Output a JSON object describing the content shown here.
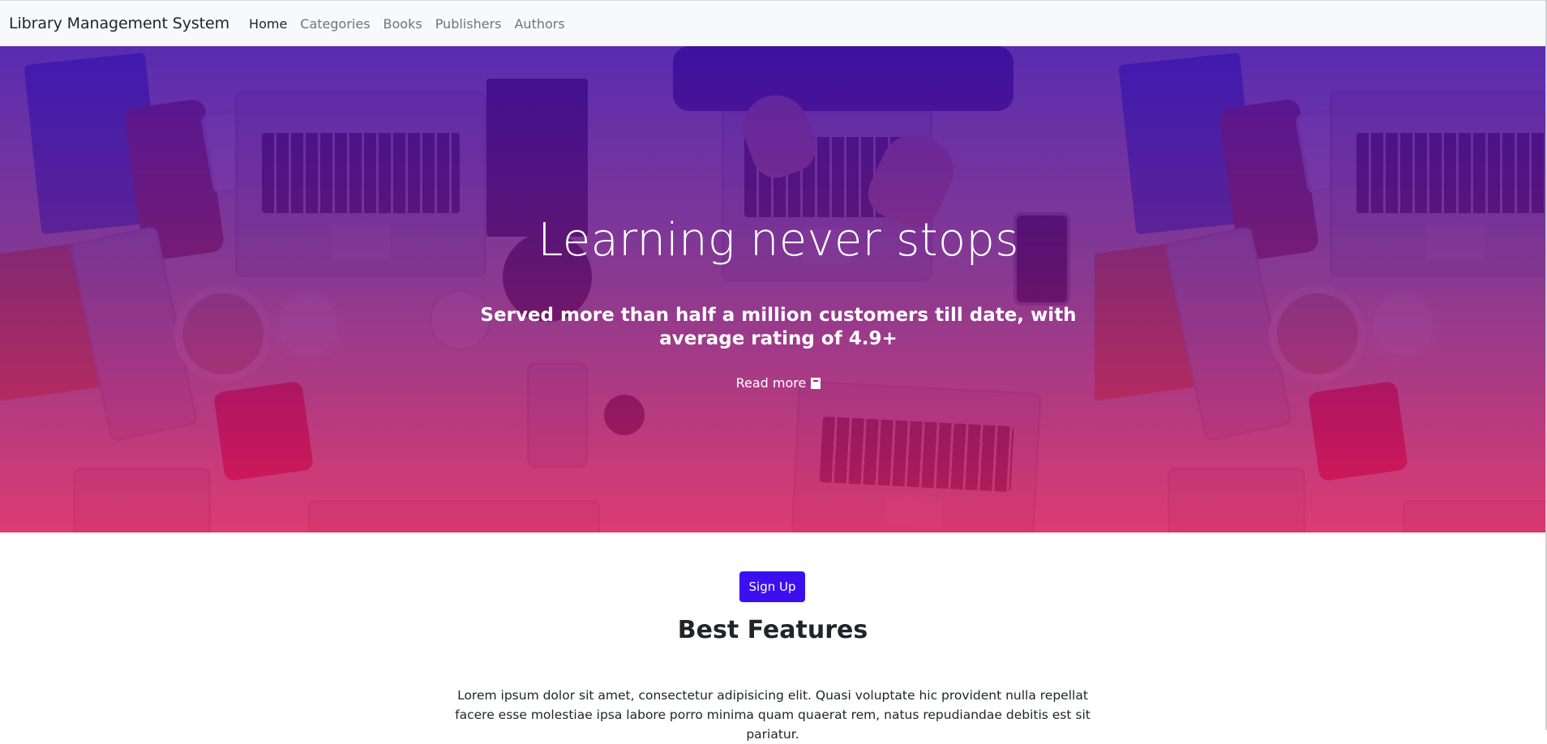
{
  "navbar": {
    "brand": "Library Management System",
    "links": [
      {
        "label": "Home",
        "active": true
      },
      {
        "label": "Categories",
        "active": false
      },
      {
        "label": "Books",
        "active": false
      },
      {
        "label": "Publishers",
        "active": false
      },
      {
        "label": "Authors",
        "active": false
      }
    ]
  },
  "hero": {
    "title": "Learning never stops",
    "subtitle": "Served more than half a million customers till date, with average rating of 4.9+",
    "read_more": "Read more",
    "read_more_icon": "book-icon",
    "gradient_top": "#400aaa",
    "gradient_bottom": "#dc185a"
  },
  "cta": {
    "signup_label": "Sign Up",
    "color": "#3c0ff0"
  },
  "features": {
    "title": "Best Features",
    "text": "Lorem ipsum dolor sit amet, consectetur adipisicing elit. Quasi voluptate hic provident nulla repellat facere esse molestiae ipsa labore porro minima quam quaerat rem, natus repudiandae debitis est sit pariatur."
  }
}
